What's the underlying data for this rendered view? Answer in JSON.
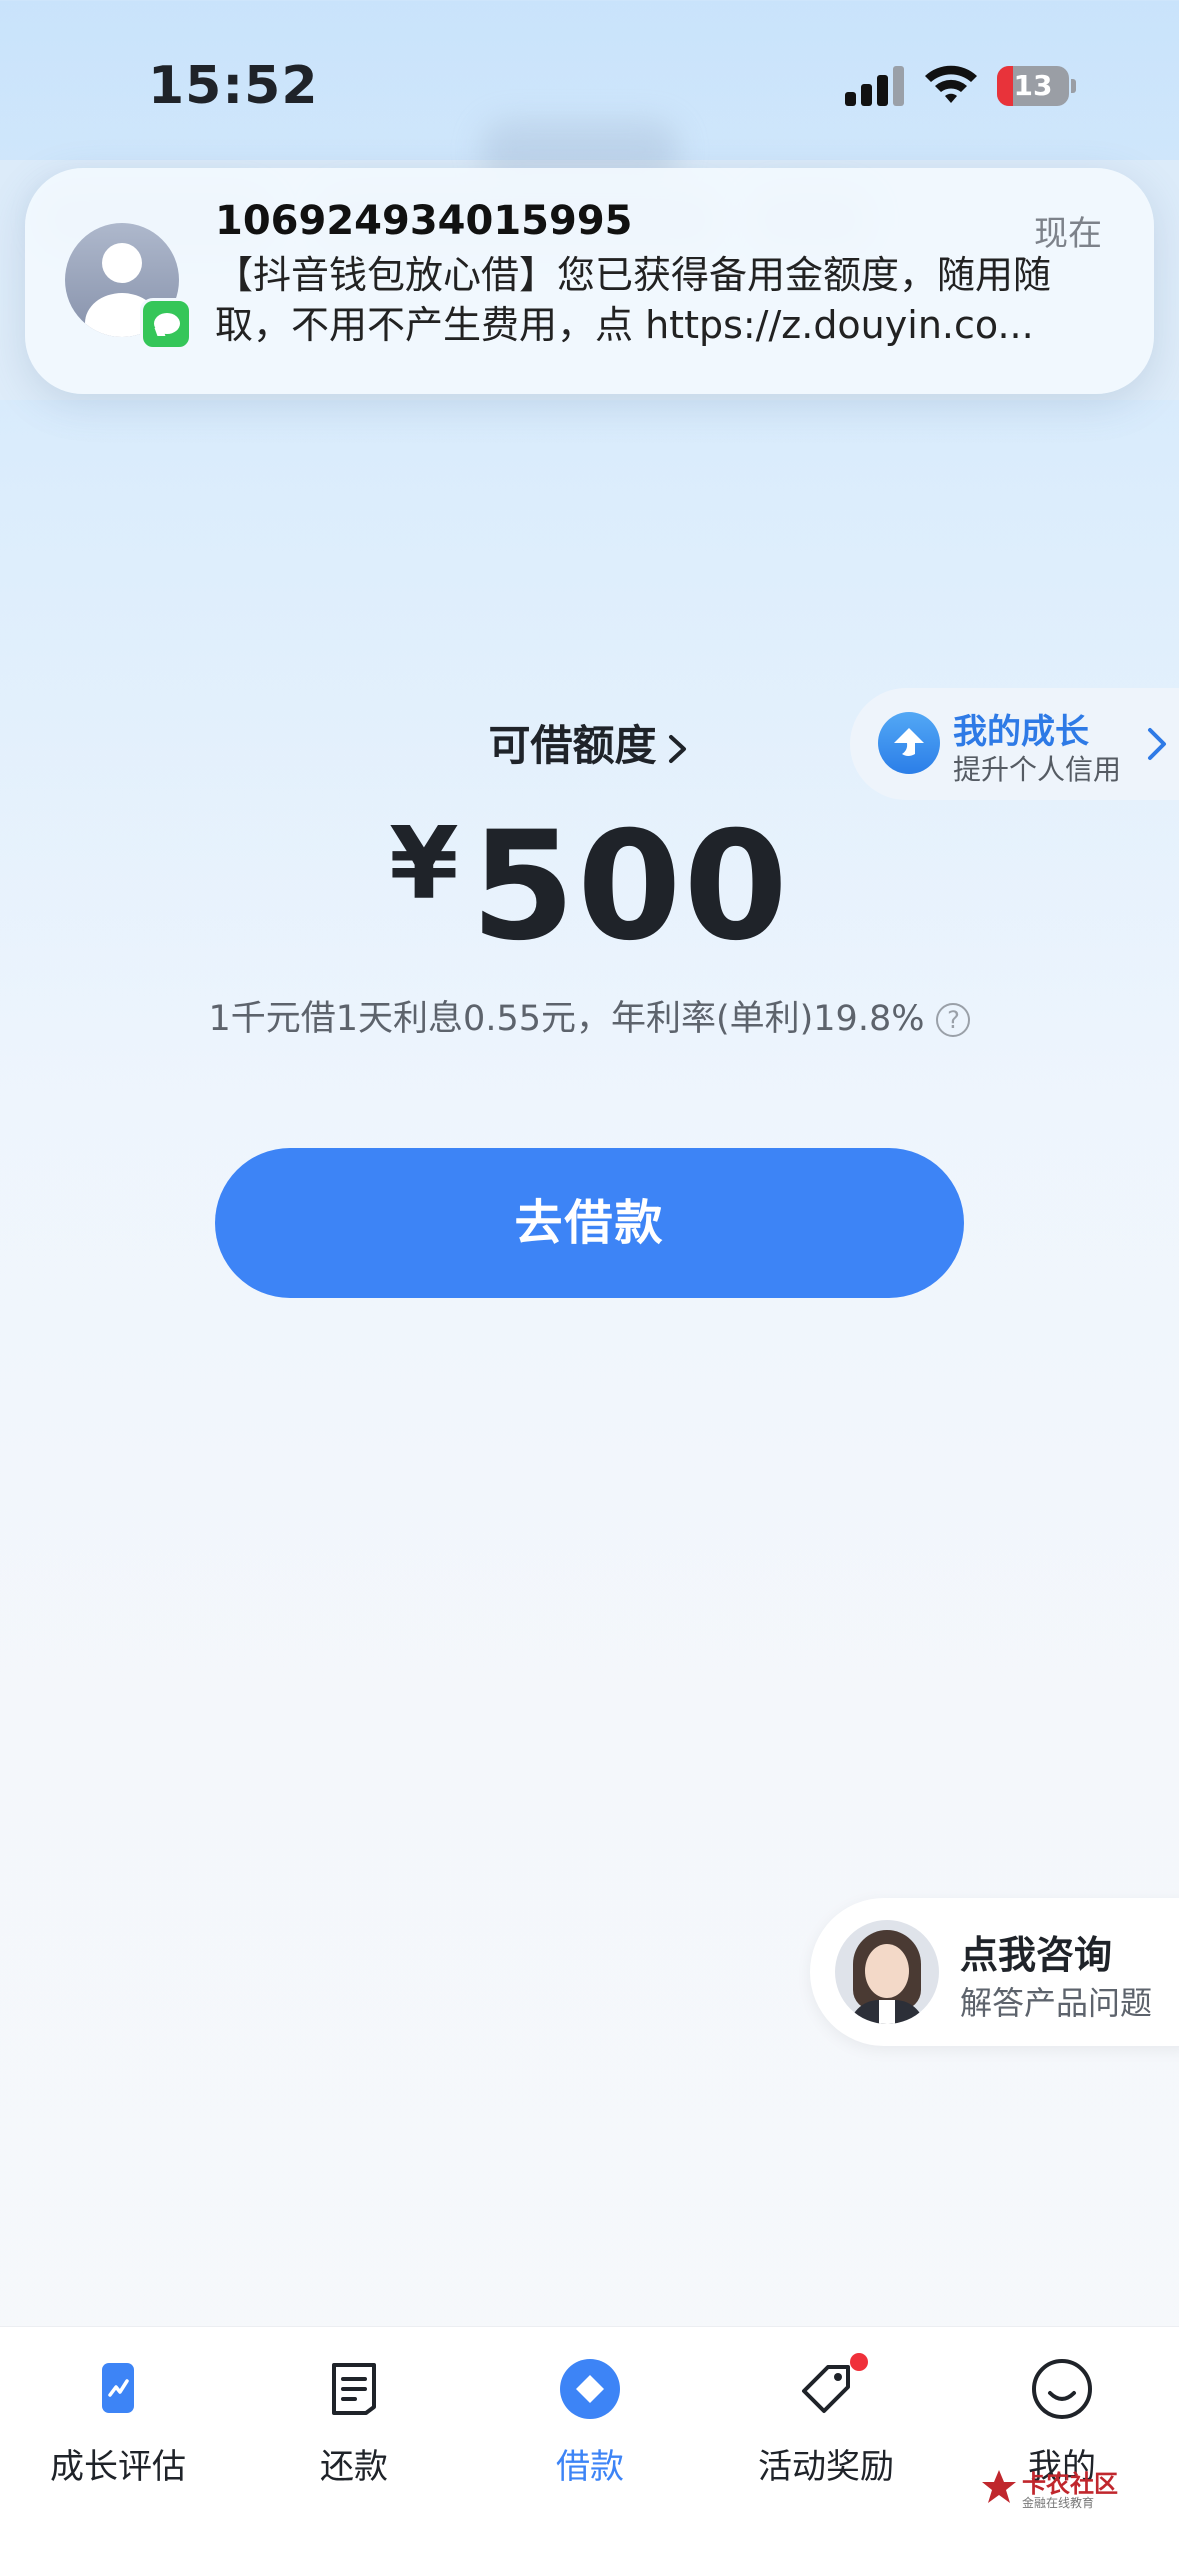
{
  "status_bar": {
    "time": "15:52",
    "battery": "13",
    "battery_color": "#e8333a"
  },
  "notification": {
    "sender": "106924934015995",
    "time": "现在",
    "line1": "【抖音钱包放心借】您已获得备用金额度，随用随",
    "line2": "取，不用不产生费用，点 https://z.douyin.co...",
    "icon": "messages-app-icon"
  },
  "growth": {
    "title": "我的成长",
    "subtitle": "提升个人信用"
  },
  "credit": {
    "label": "可借额度",
    "currency": "¥",
    "amount": "500",
    "interest_text": "1千元借1天利息0.55元，年利率(单利)19.8%",
    "help_symbol": "?"
  },
  "borrow_button": {
    "label": "去借款",
    "color": "#3d84f6"
  },
  "consult": {
    "title": "点我咨询",
    "subtitle": "解答产品问题"
  },
  "tabbar": {
    "items": [
      {
        "label": "成长评估",
        "icon": "growth-assessment-icon",
        "active": false
      },
      {
        "label": "还款",
        "icon": "repayment-icon",
        "active": false
      },
      {
        "label": "借款",
        "icon": "borrow-icon",
        "active": true
      },
      {
        "label": "活动奖励",
        "icon": "reward-tag-icon",
        "active": false,
        "badge_dot": true
      },
      {
        "label": "我的",
        "icon": "smile-profile-icon",
        "active": false
      }
    ],
    "active_color": "#3d84f6"
  },
  "watermark": {
    "title": "卡农社区",
    "subtitle": "金融在线教育"
  }
}
